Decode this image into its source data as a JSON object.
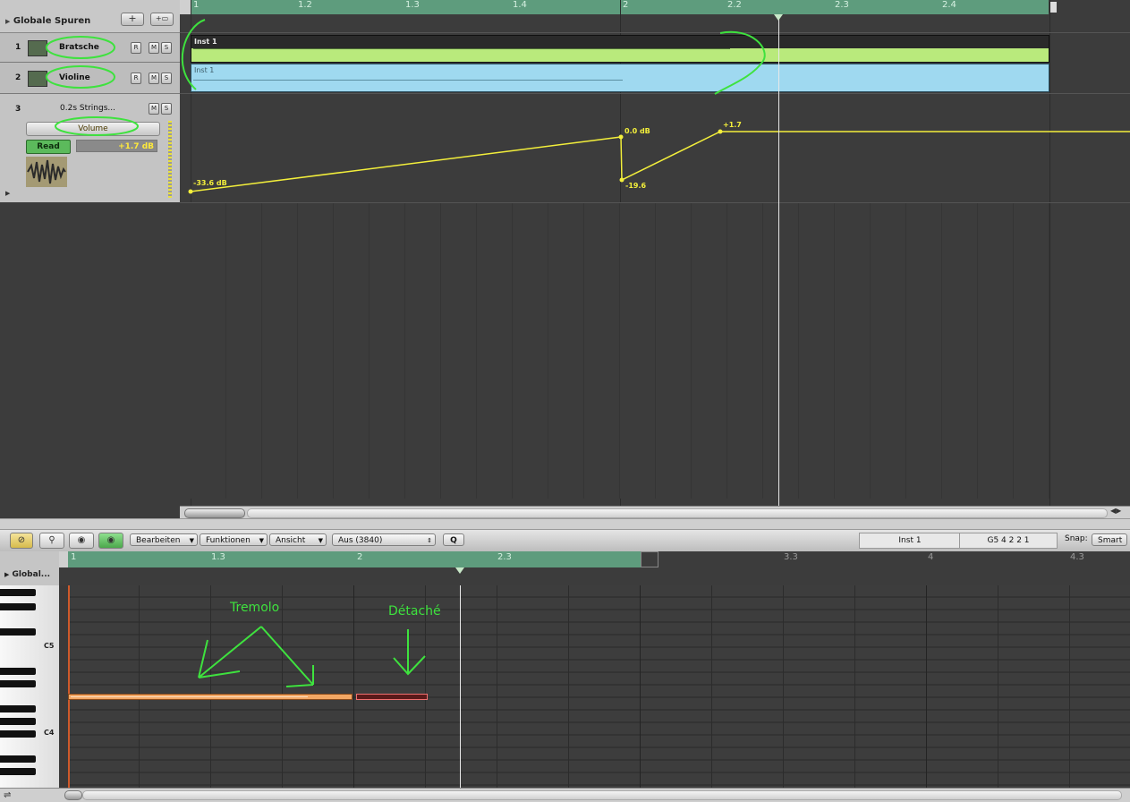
{
  "global_tracks": {
    "label": "Globale Spuren",
    "add": "+",
    "add_folder": "+▭"
  },
  "arrange_ruler": [
    "1",
    "1.2",
    "1.3",
    "1.4",
    "2",
    "2.2",
    "2.3",
    "2.4"
  ],
  "tracks": [
    {
      "number": "1",
      "name": "Bratsche",
      "buttons": [
        "R",
        "M",
        "S"
      ]
    },
    {
      "number": "2",
      "name": "Violine",
      "buttons": [
        "R",
        "M",
        "S"
      ]
    },
    {
      "number": "3",
      "name": "0.2s Strings...",
      "buttons": [
        "M",
        "S"
      ],
      "automation_param": "Volume",
      "mode": "Read",
      "value": "+1.7 dB"
    }
  ],
  "regions": [
    {
      "title": "Inst 1",
      "color": "#b9ea7c",
      "header_color": "#2a2a2a"
    },
    {
      "title": "Inst 1",
      "color": "#9fd9f0",
      "header_color": "#a8ddf1"
    }
  ],
  "automation_labels": {
    "p1": "-33.6 dB",
    "p2": "0.0 dB",
    "p3": "-19.6",
    "p4": "+1.7"
  },
  "piano_roll": {
    "toolbar": {
      "bearbeiten": "Bearbeiten",
      "funktionen": "Funktionen",
      "ansicht": "Ansicht",
      "quantize": "Aus (3840)",
      "q": "Q",
      "region_name": "Inst 1",
      "position": "G5   4 2 2 1",
      "snap_label": "Snap:",
      "snap_value": "Smart"
    },
    "left_label": "Global...",
    "ruler": [
      "1",
      "1.3",
      "2",
      "2.3",
      "3.3",
      "4",
      "4.3"
    ],
    "key_labels": {
      "c5": "C5",
      "c4": "C4"
    }
  },
  "annotations": {
    "tremolo": "Tremolo",
    "detache": "Détaché"
  },
  "colors": {
    "ruler": "#5e9c7d",
    "annotation": "#3ee23e",
    "note_orange": "#f3a764",
    "automation": "#f3ef3b"
  }
}
